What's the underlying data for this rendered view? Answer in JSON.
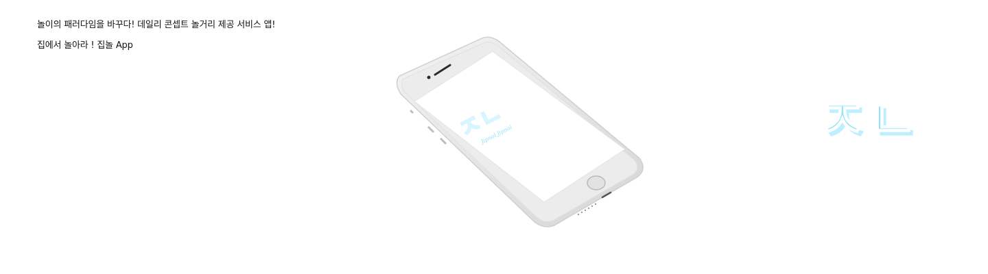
{
  "intro": {
    "headline": "놀이의 패러다임을 바꾸다! 데일리 콘셉트 놀거리 제공 서비스 앱!",
    "subline": "집에서 놀아라 ! 집놀 App"
  },
  "phone": {
    "screen_logo_glyphs": "ㅈㄴ",
    "screen_logo_script": "Jipnol Jipnol"
  },
  "logo": {
    "glyphs": "ㅈㄴ"
  },
  "colors": {
    "brand_cyan": "#8fe3fc",
    "brand_cyan_shadow": "#ffffff",
    "phone_body": "#e8e8e8"
  }
}
